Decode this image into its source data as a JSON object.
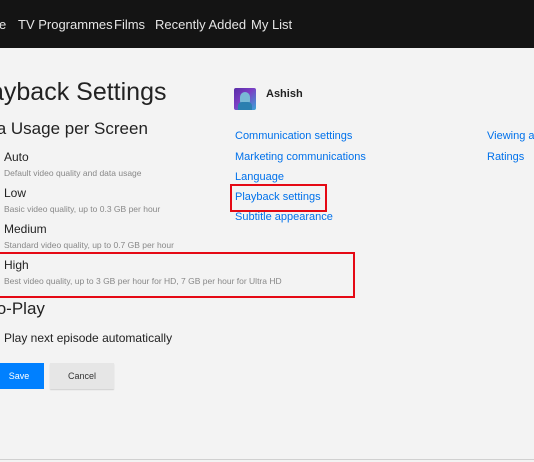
{
  "nav": {
    "items": [
      {
        "label": "e"
      },
      {
        "label": "TV Programmes"
      },
      {
        "label": "Films"
      },
      {
        "label": "Recently Added"
      },
      {
        "label": "My List"
      }
    ]
  },
  "page": {
    "title": "ayback Settings",
    "data_usage": {
      "title": "ta Usage per Screen",
      "options": [
        {
          "label": "Auto",
          "desc": "Default video quality and data usage"
        },
        {
          "label": "Low",
          "desc": "Basic video quality, up to 0.3 GB per hour"
        },
        {
          "label": "Medium",
          "desc": "Standard video quality, up to 0.7 GB per hour"
        },
        {
          "label": "High",
          "desc": "Best video quality, up to 3 GB per hour for HD, 7 GB per hour for Ultra HD"
        }
      ]
    },
    "autoplay": {
      "title": "to-Play",
      "option": "Play next episode automatically"
    },
    "buttons": {
      "save": "Save",
      "cancel": "Cancel"
    }
  },
  "profile": {
    "name": "Ashish",
    "links_col1": [
      {
        "label": "Communication settings"
      },
      {
        "label": "Marketing communications"
      },
      {
        "label": "Language"
      },
      {
        "label": "Playback settings"
      },
      {
        "label": "Subtitle appearance"
      }
    ],
    "links_col2": [
      {
        "label": "Viewing a"
      },
      {
        "label": "Ratings"
      }
    ]
  },
  "colors": {
    "accent": "#0071eb",
    "highlight": "#e50914",
    "save_button": "#0080ff",
    "topbar": "#141414"
  }
}
